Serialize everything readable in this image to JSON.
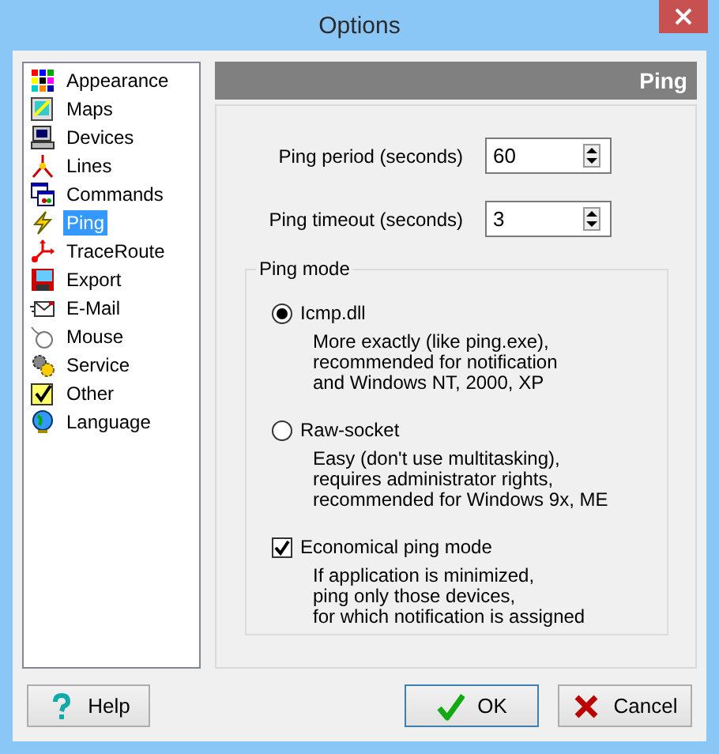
{
  "window": {
    "title": "Options"
  },
  "sidebar": {
    "items": [
      {
        "label": "Appearance",
        "selected": false
      },
      {
        "label": "Maps",
        "selected": false
      },
      {
        "label": "Devices",
        "selected": false
      },
      {
        "label": "Lines",
        "selected": false
      },
      {
        "label": "Commands",
        "selected": false
      },
      {
        "label": "Ping",
        "selected": true
      },
      {
        "label": "TraceRoute",
        "selected": false
      },
      {
        "label": "Export",
        "selected": false
      },
      {
        "label": "E-Mail",
        "selected": false
      },
      {
        "label": "Mouse",
        "selected": false
      },
      {
        "label": "Service",
        "selected": false
      },
      {
        "label": "Other",
        "selected": false
      },
      {
        "label": "Language",
        "selected": false
      }
    ]
  },
  "panel": {
    "header": "Ping",
    "fields": [
      {
        "label": "Ping period (seconds)",
        "value": "60"
      },
      {
        "label": "Ping timeout (seconds)",
        "value": "3"
      }
    ],
    "group": {
      "title": "Ping mode",
      "options": [
        {
          "kind": "radio",
          "label": "Icmp.dll",
          "selected": true,
          "description": "More exactly (like ping.exe),\nrecommended for notification\nand Windows NT, 2000, XP"
        },
        {
          "kind": "radio",
          "label": "Raw-socket",
          "selected": false,
          "description": "Easy (don't use multitasking),\nrequires administrator rights,\nrecommended for Windows 9x, ME"
        },
        {
          "kind": "checkbox",
          "label": "Economical ping mode",
          "checked": true,
          "description": "If application is minimized,\nping only those devices,\nfor which notification is assigned"
        }
      ]
    }
  },
  "buttons": [
    {
      "kind": "help",
      "label": "Help",
      "default": false
    },
    {
      "kind": "ok",
      "label": "OK",
      "default": true
    },
    {
      "kind": "cancel",
      "label": "Cancel",
      "default": false
    }
  ]
}
